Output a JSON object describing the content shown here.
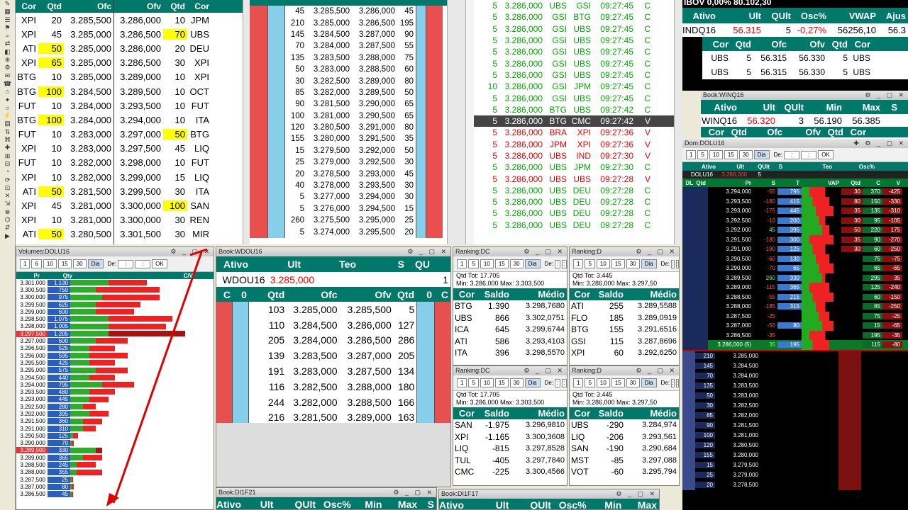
{
  "ob_left": {
    "headers": [
      "Cor",
      "Qtd",
      "Ofc",
      "Ofv",
      "Qtd",
      "Cor"
    ],
    "rows": [
      [
        "XPI",
        "20",
        "3.285,500",
        "3.286,000",
        "10",
        "JPM"
      ],
      [
        "XPI",
        "45",
        "3.285,000",
        "3.286,500",
        "70",
        "UBS"
      ],
      [
        "ATI",
        "50",
        "3.285,000",
        "3.286,000",
        "20",
        "DEU"
      ],
      [
        "XPI",
        "65",
        "3.285,000",
        "3.286,500",
        "30",
        "XPI"
      ],
      [
        "BTG",
        "10",
        "3.285,000",
        "3.289,000",
        "10",
        "XPI"
      ],
      [
        "BTG",
        "100",
        "3.284,500",
        "3.289,500",
        "10",
        "OCT"
      ],
      [
        "FUT",
        "10",
        "3.284,000",
        "3.293,500",
        "10",
        "FUT"
      ],
      [
        "BTG",
        "100",
        "3.284,000",
        "3.294,000",
        "10",
        "ITA"
      ],
      [
        "FUT",
        "10",
        "3.283,000",
        "3.297,000",
        "50",
        "BTG"
      ],
      [
        "XPI",
        "10",
        "3.283,000",
        "3.297,500",
        "45",
        "LIQ"
      ],
      [
        "FUT",
        "10",
        "3.282,000",
        "3.298,000",
        "10",
        "FUT"
      ],
      [
        "XPI",
        "10",
        "3.282,000",
        "3.299,000",
        "15",
        "LIQ"
      ],
      [
        "ATI",
        "50",
        "3.281,500",
        "3.299,500",
        "30",
        "ITA"
      ],
      [
        "XPI",
        "45",
        "3.281,000",
        "3.300,000",
        "100",
        "SAN"
      ],
      [
        "XPI",
        "10",
        "3.281,000",
        "3.300,000",
        "30",
        "REN"
      ],
      [
        "ATI",
        "50",
        "3.280,500",
        "3.301,500",
        "30",
        "MIR"
      ]
    ]
  },
  "ob_mid": {
    "headers": [
      "C",
      "0",
      "",
      "",
      "",
      "",
      "0",
      "C"
    ],
    "rows": [
      [
        "45",
        "3.285,500",
        "3.286,000",
        "45"
      ],
      [
        "210",
        "3.285,000",
        "3.286,500",
        "195"
      ],
      [
        "145",
        "3.284,500",
        "3.287,000",
        "90"
      ],
      [
        "70",
        "3.284,000",
        "3.287,500",
        "55"
      ],
      [
        "135",
        "3.283,500",
        "3.288,000",
        "75"
      ],
      [
        "50",
        "3.283,000",
        "3.288,500",
        "60"
      ],
      [
        "30",
        "3.282,500",
        "3.289,000",
        "80"
      ],
      [
        "85",
        "3.282,000",
        "3.289,500",
        "50"
      ],
      [
        "90",
        "3.281,500",
        "3.290,000",
        "65"
      ],
      [
        "100",
        "3.281,000",
        "3.290,500",
        "65"
      ],
      [
        "120",
        "3.280,500",
        "3.291,000",
        "80"
      ],
      [
        "155",
        "3.280,000",
        "3.291,500",
        "35"
      ],
      [
        "15",
        "3.279,500",
        "3.292,000",
        "50"
      ],
      [
        "25",
        "3.279,000",
        "3.292,500",
        "30"
      ],
      [
        "20",
        "3.278,500",
        "3.293,000",
        "45"
      ],
      [
        "40",
        "3.278,000",
        "3.293,500",
        "30"
      ],
      [
        "5",
        "3.277,000",
        "3.294,000",
        "30"
      ],
      [
        "5",
        "3.276,000",
        "3.294,500",
        "15"
      ],
      [
        "260",
        "3.275,500",
        "3.295,000",
        "25"
      ],
      [
        "5",
        "3.274,000",
        "3.295,500",
        "20"
      ]
    ]
  },
  "trades": {
    "rows": [
      [
        "5",
        "3.286,000",
        "UBS",
        "GSI",
        "09:27:45",
        "C"
      ],
      [
        "5",
        "3.286,000",
        "GSI",
        "BTG",
        "09:27:45",
        "C"
      ],
      [
        "5",
        "3.286,000",
        "GSI",
        "UBS",
        "09:27:45",
        "C"
      ],
      [
        "5",
        "3.286,000",
        "GSI",
        "UBS",
        "09:27:45",
        "C"
      ],
      [
        "5",
        "3.286,000",
        "GSI",
        "UBS",
        "09:27:45",
        "C"
      ],
      [
        "5",
        "3.286,000",
        "GSI",
        "UBS",
        "09:27:45",
        "C"
      ],
      [
        "5",
        "3.286,000",
        "GSI",
        "UBS",
        "09:27:45",
        "C"
      ],
      [
        "10",
        "3.286,000",
        "GSI",
        "JPM",
        "09:27:45",
        "C"
      ],
      [
        "5",
        "3.286,000",
        "GSI",
        "UBS",
        "09:27:45",
        "C"
      ],
      [
        "5",
        "3.286,000",
        "BTG",
        "UBS",
        "09:27:42",
        "C"
      ],
      [
        "5",
        "3.286,000",
        "BTG",
        "CMC",
        "09:27:42",
        "V"
      ],
      [
        "5",
        "3.286,000",
        "BRA",
        "XPI",
        "09:27:36",
        "V"
      ],
      [
        "5",
        "3.286,000",
        "JPM",
        "XPI",
        "09:27:36",
        "V"
      ],
      [
        "5",
        "3.286,000",
        "UBS",
        "IND",
        "09:27:30",
        "V"
      ],
      [
        "5",
        "3.286,000",
        "UBS",
        "JPM",
        "09:27:30",
        "C"
      ],
      [
        "5",
        "3.286,000",
        "UBS",
        "UBS",
        "09:27:28",
        "V"
      ],
      [
        "5",
        "3.286,000",
        "UBS",
        "DEU",
        "09:27:28",
        "C"
      ],
      [
        "5",
        "3.286,000",
        "UBS",
        "DEU",
        "09:27:28",
        "C"
      ],
      [
        "5",
        "3.286,000",
        "UBS",
        "DEU",
        "09:27:28",
        "C"
      ],
      [
        "5",
        "3.286,000",
        "UBS",
        "DEU",
        "09:27:28",
        "C"
      ]
    ]
  },
  "ibov": {
    "top": "IBOV   0,00%     80.102,30",
    "hdr": [
      "Ativo",
      "Ult",
      "QUlt",
      "Osc%",
      "VWAP",
      "Ajus"
    ],
    "row": [
      "INDQ16",
      "56.315",
      "5",
      "-0,27%",
      "56256,10",
      "56.3"
    ],
    "sub_hdr": [
      "Cor",
      "Qtd",
      "Ofc",
      "Ofv",
      "Qtd",
      "Cor"
    ],
    "sub_rows": [
      [
        "UBS",
        "5",
        "56.315",
        "56.330",
        "5",
        "UBS"
      ],
      [
        "UBS",
        "5",
        "56.315",
        "56.330",
        "5",
        "UBS"
      ]
    ]
  },
  "winq": {
    "title": "Book:WINQ16",
    "hdr": [
      "Ativo",
      "Ult",
      "QUlt",
      "Min",
      "Max",
      "S"
    ],
    "row": [
      "WINQ16",
      "56.320",
      "3",
      "56.190",
      "56.385",
      ""
    ],
    "sub_hdr": [
      "Cor",
      "Qtd",
      "Ofc",
      "Ofv",
      "Qtd",
      "Cor"
    ]
  },
  "dom": {
    "title": "Dom:DOLU16",
    "btns": [
      "1",
      "5",
      "10",
      "15",
      "30",
      "Dia",
      "De:",
      "OK"
    ],
    "hdr": [
      "Ativo",
      "Ult",
      "QUlt",
      "S",
      "Teo",
      "Osc%"
    ],
    "ativo": "DOLU16",
    "ult": "3.286,000",
    "qult": "5",
    "cols": [
      "DL",
      "Qtd",
      "Pr",
      "S",
      "T",
      "VAP",
      "Qtd",
      "C",
      "V"
    ],
    "rows": [
      [
        "3.294,000",
        "-55",
        "795",
        "30",
        "370",
        "-425"
      ],
      [
        "3.293,500",
        "-180",
        "415",
        "80",
        "150",
        "-330"
      ],
      [
        "3.293,000",
        "-175",
        "445",
        "35",
        "135",
        "-310"
      ],
      [
        "3.292,500",
        "-10",
        "200",
        "30",
        "95",
        "-105"
      ],
      [
        "3.292,000",
        "45",
        "395",
        "50",
        "220",
        "175"
      ],
      [
        "3.291,500",
        "-180",
        "300",
        "35",
        "90",
        "-270"
      ],
      [
        "3.291,000",
        "-190",
        "125",
        "30",
        "60",
        "-250"
      ],
      [
        "3.290,500",
        "-60",
        "130",
        "",
        "75",
        "-75"
      ],
      [
        "3.290,000",
        "-70",
        "65",
        "",
        "65",
        "-65"
      ],
      [
        "3.289,500",
        "260",
        "330",
        "",
        "295",
        "35"
      ],
      [
        "3.289,000",
        "-115",
        "365",
        "",
        "125",
        "-240"
      ],
      [
        "3.288,500",
        "-55",
        "215",
        "",
        "60",
        "-150"
      ],
      [
        "3.288,000",
        "-185",
        "315",
        "",
        "65",
        "-250"
      ],
      [
        "3.287,500",
        "-25",
        "",
        "",
        "75",
        "-25"
      ],
      [
        "3.287,000",
        "-50",
        "80",
        "",
        "15",
        "-65"
      ],
      [
        "3.286,500",
        "-35",
        "",
        "",
        "195",
        "-35"
      ],
      [
        "3.286,000 (5)",
        "35",
        "195",
        "",
        "115",
        "-80"
      ]
    ],
    "low_rows": [
      [
        "210",
        "3.285,000"
      ],
      [
        "145",
        "3.284,500"
      ],
      [
        "70",
        "3.284,000"
      ],
      [
        "135",
        "3.283,500"
      ],
      [
        "50",
        "3.283,000"
      ],
      [
        "30",
        "3.282,500"
      ],
      [
        "85",
        "3.282,000"
      ],
      [
        "90",
        "3.281,500"
      ],
      [
        "100",
        "3.281,000"
      ],
      [
        "120",
        "3.280,500"
      ],
      [
        "155",
        "3.280,000"
      ],
      [
        "15",
        "3.279,500"
      ],
      [
        "25",
        "3.279,000"
      ],
      [
        "20",
        "3.278,500"
      ]
    ]
  },
  "vol": {
    "title": "Volumes:DOLU16",
    "btns": [
      "1",
      "6",
      "10",
      "15",
      "30",
      "Dia",
      "De:",
      "OK"
    ],
    "hdr": [
      "Pr",
      "Qty",
      "C/V"
    ],
    "rows": [
      [
        "3.301,000",
        "1.130",
        0.3,
        0.3
      ],
      [
        "3.300,500",
        "750",
        0.2,
        0.5
      ],
      [
        "3.300,000",
        "975",
        0.25,
        0.45
      ],
      [
        "3.299,500",
        "625",
        0.2,
        0.35
      ],
      [
        "3.299,000",
        "600",
        0.2,
        0.3
      ],
      [
        "3.298,500",
        "1.075",
        0.3,
        0.5
      ],
      [
        "3.298,000",
        "1.005",
        0.3,
        0.45
      ],
      [
        "3.297,500",
        "1.205",
        0.3,
        0.6
      ],
      [
        "3.297,000",
        "600",
        0.2,
        0.25
      ],
      [
        "3.296,500",
        "525",
        0.15,
        0.2
      ],
      [
        "3.296,000",
        "595",
        0.15,
        0.3
      ],
      [
        "3.295,500",
        "425",
        0.15,
        0.2
      ],
      [
        "3.295,000",
        "575",
        0.2,
        0.25
      ],
      [
        "3.294,500",
        "440",
        0.15,
        0.2
      ],
      [
        "3.294,000",
        "795",
        0.25,
        0.25
      ],
      [
        "3.293,500",
        "480",
        0.15,
        0.2
      ],
      [
        "3.293,000",
        "445",
        0.15,
        0.15
      ],
      [
        "3.292,500",
        "280",
        0.1,
        0.1
      ],
      [
        "3.292,000",
        "395",
        0.15,
        0.15
      ],
      [
        "3.291,500",
        "360",
        0.1,
        0.15
      ],
      [
        "3.291,000",
        "310",
        0.1,
        0.1
      ],
      [
        "3.290,500",
        "125",
        0.02,
        0.04
      ],
      [
        "3.290,000",
        "70",
        0.01,
        0.02
      ],
      [
        "3.289,500",
        "330",
        0.2,
        0.05
      ],
      [
        "3.289,000",
        "365",
        0.1,
        0.15
      ],
      [
        "3.288,500",
        "245",
        0.05,
        0.15
      ],
      [
        "3.288,000",
        "355",
        0.05,
        0.2
      ],
      [
        "3.287,500",
        "25",
        0.01,
        0.01
      ],
      [
        "3.287,000",
        "80",
        0.01,
        0.02
      ],
      [
        "3.286,500",
        "45",
        0.01,
        0.01
      ]
    ]
  },
  "wdou": {
    "title": "Book:WDOU16",
    "hdr": [
      "Ativo",
      "Ult",
      "Teo",
      "S",
      "QU"
    ],
    "ativo": "WDOU16",
    "ult": "3.285,000",
    "qu": "1",
    "sub_hdr": [
      "C",
      "0",
      "Qtd",
      "Ofc",
      "Ofv",
      "Qtd",
      "0",
      "C"
    ],
    "rows": [
      [
        "103",
        "3.285,000",
        "3.285,500",
        "5"
      ],
      [
        "110",
        "3.284,500",
        "3.286,000",
        "127"
      ],
      [
        "205",
        "3.284,000",
        "3.286,500",
        "286"
      ],
      [
        "139",
        "3.283,500",
        "3.287,000",
        "205"
      ],
      [
        "191",
        "3.283,000",
        "3.287,500",
        "134"
      ],
      [
        "116",
        "3.282,500",
        "3.288,000",
        "180"
      ],
      [
        "244",
        "3.282,000",
        "3.288,500",
        "166"
      ],
      [
        "216",
        "3.281,500",
        "3.289,000",
        "163"
      ]
    ]
  },
  "rank": [
    {
      "title": "Ranking:DC",
      "btns": [
        "1",
        "5",
        "10",
        "15",
        "30",
        "Dia",
        "De:"
      ],
      "qtd": "Qtd Tot:  17.705",
      "minmax": "Min: 3.286,000   Max: 3.303,500",
      "hdr": [
        "Cor",
        "Saldo",
        "Médio"
      ],
      "rows": [
        [
          "BTG",
          "1.390",
          "3.298,7680"
        ],
        [
          "UBS",
          "866",
          "3.302,0751"
        ],
        [
          "ICA",
          "645",
          "3.299,6744"
        ],
        [
          "ATI",
          "586",
          "3.293,4103"
        ],
        [
          "ITA",
          "396",
          "3.298,5570"
        ]
      ]
    },
    {
      "title": "Ranking:D",
      "btns": [
        "1",
        "5",
        "10",
        "15",
        "30",
        "Dia",
        "De:"
      ],
      "qtd": "Qtd Tot:  3.445",
      "minmax": "Min: 3.286,000   Max: 3.297,50",
      "hdr": [
        "Cor",
        "Saldo",
        "Médio"
      ],
      "rows": [
        [
          "ATI",
          "255",
          "3.289,5588"
        ],
        [
          "FLO",
          "185",
          "3.289,0919"
        ],
        [
          "BTG",
          "155",
          "3.291,6516"
        ],
        [
          "GSI",
          "115",
          "3.287,8696"
        ],
        [
          "XPI",
          "60",
          "3.292,6250"
        ]
      ]
    },
    {
      "title": "Ranking:DC",
      "btns": [
        "1",
        "5",
        "10",
        "15",
        "30",
        "Dia",
        "De:"
      ],
      "qtd": "Qtd Tot:  17.705",
      "minmax": "Min: 3.286,000   Max: 3.303,500",
      "hdr": [
        "Cor",
        "Saldo",
        "Médio"
      ],
      "rows": [
        [
          "SAN",
          "-1.975",
          "3.296,9810"
        ],
        [
          "XPI",
          "-1.165",
          "3.300,3608"
        ],
        [
          "LIQ",
          "-815",
          "3.297,8528"
        ],
        [
          "TUL",
          "-405",
          "3.297,7840"
        ],
        [
          "CMC",
          "-225",
          "3.300,4566"
        ]
      ]
    },
    {
      "title": "Ranking:D",
      "btns": [
        "1",
        "5",
        "10",
        "15",
        "30",
        "Dia",
        "De:"
      ],
      "qtd": "Qtd Tot:  3.445",
      "minmax": "Min: 3.286,000   Max: 3.297,50",
      "hdr": [
        "Cor",
        "Saldo",
        "Médio"
      ],
      "rows": [
        [
          "UBS",
          "-290",
          "3.284,974"
        ],
        [
          "LIQ",
          "-206",
          "3.293,561"
        ],
        [
          "SAN",
          "-190",
          "3.290,684"
        ],
        [
          "MST",
          "-85",
          "3.297,088"
        ],
        [
          "VOT",
          "-60",
          "3.295,794"
        ]
      ]
    }
  ],
  "di1": {
    "title": "Book:DI1F21",
    "hdr": [
      "Ativo",
      "Ult",
      "QUlt",
      "Osc%",
      "Min",
      "Max",
      "S"
    ]
  },
  "di2": {
    "title": "Book:DI1F17",
    "hdr": [
      "Ativo",
      "Ult",
      "QUlt",
      "Osc%",
      "Min",
      "Max"
    ]
  },
  "colors": {
    "teal": "#00796b",
    "buy": "#e84f4f",
    "sell": "#87ceeb",
    "yellow": "#ffff00",
    "arrow": "#e00000"
  }
}
